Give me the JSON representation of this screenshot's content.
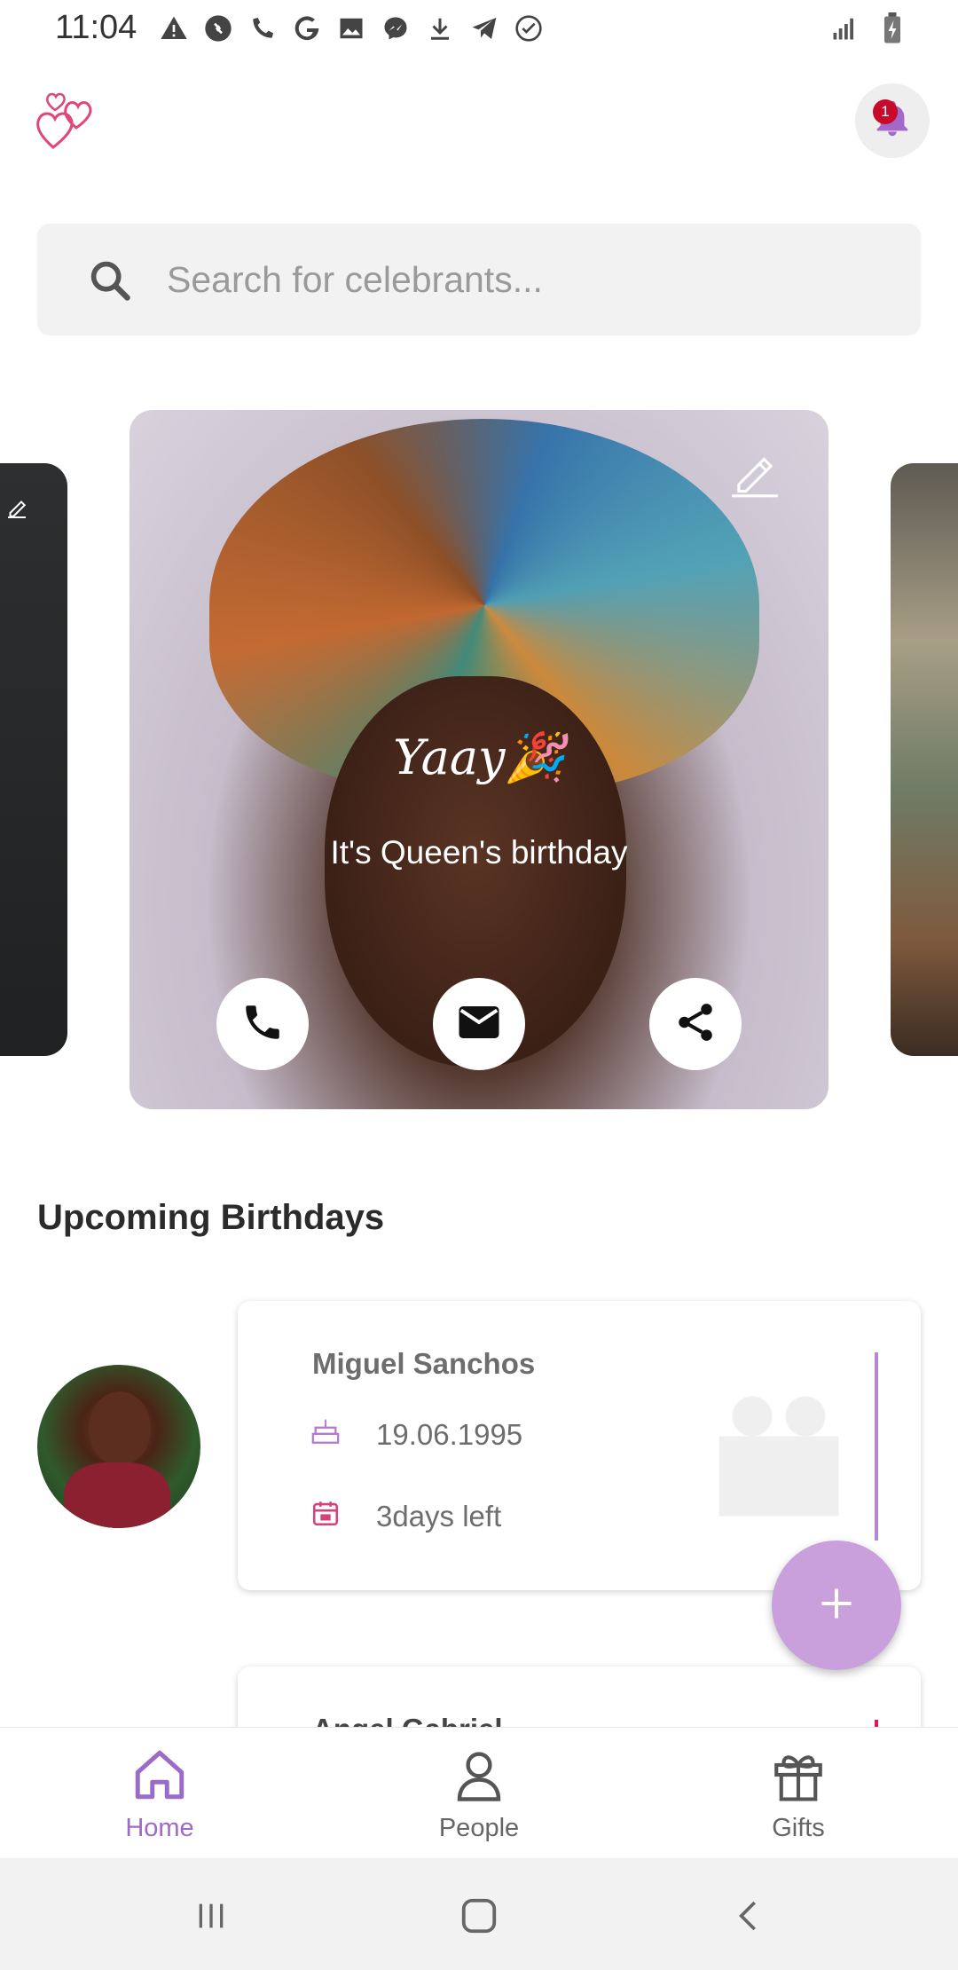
{
  "status_bar": {
    "time": "11:04",
    "icons": [
      "warning-icon",
      "shazam-icon",
      "wifi-calling-off-icon",
      "google-icon",
      "gallery-icon",
      "messenger-icon",
      "download-icon",
      "telegram-icon",
      "check-circle-icon"
    ],
    "right_icons": [
      "signal-icon",
      "battery-charging-icon"
    ]
  },
  "header": {
    "logo_icon": "hearts-icon",
    "notification_count": "1"
  },
  "search": {
    "placeholder": "Search for celebrants..."
  },
  "featured": {
    "title": "Yaay",
    "subtitle": "It's Queen's birthday",
    "actions": [
      "phone-icon",
      "mail-icon",
      "share-icon"
    ]
  },
  "upcoming": {
    "title": "Upcoming Birthdays",
    "items": [
      {
        "name": "Miguel Sanchos",
        "date": "19.06.1995",
        "days_left": "3days left"
      },
      {
        "name": "Angel Gabriel"
      }
    ]
  },
  "bottom_nav": {
    "items": [
      {
        "label": "Home",
        "active": true
      },
      {
        "label": "People",
        "active": false
      },
      {
        "label": "Gifts",
        "active": false
      }
    ]
  },
  "colors": {
    "accent": "#9c6bc8",
    "fab": "#c9a0dc",
    "badge": "#c70a2a",
    "pink": "#d81b60"
  }
}
